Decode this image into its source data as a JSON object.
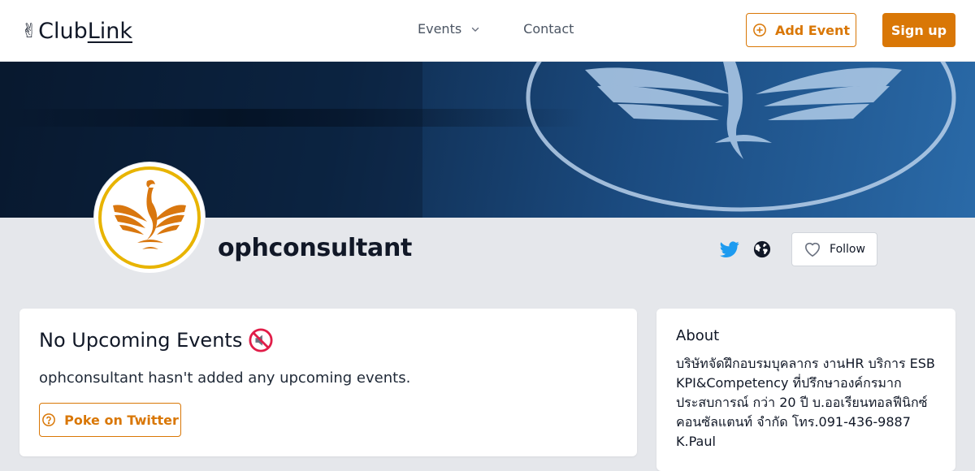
{
  "header": {
    "logo_hand": "✌",
    "logo_club": "Club",
    "logo_link": "Link",
    "nav": {
      "events_label": "Events",
      "contact_label": "Contact"
    },
    "add_event_label": "Add Event",
    "signup_label": "Sign up"
  },
  "profile": {
    "name": "ophconsultant",
    "follow_label": "Follow"
  },
  "events": {
    "title": "No Upcoming Events",
    "message": "ophconsultant hasn't added any upcoming events.",
    "poke_label": "Poke on Twitter"
  },
  "about": {
    "title": "About",
    "lines": [
      "บริษัทจัดฝึกอบรมบุคลากร งานHR บริการ ESB",
      "KPI&Competency ที่ปรึกษาองค์กรมาก",
      "ประสบการณ์ กว่า 20 ปี บ.ออเรียนทอลฟีนิกซ์",
      "คอนซัลแตนท์ จำกัด โทร.091-436-9887",
      "K.Paul"
    ]
  },
  "colors": {
    "accent": "#d97706",
    "twitter": "#1d9bf0",
    "background": "#e5e7eb",
    "banner_dark": "#0a1c33"
  },
  "icons": {
    "logo": "victory-hand-icon",
    "events_dropdown": "chevron-down-icon",
    "add_event": "plus-circle-icon",
    "twitter": "twitter-icon",
    "website": "globe-icon",
    "follow": "heart-outline-icon",
    "no_events": "muted-speaker-icon",
    "poke": "question-circle-icon"
  }
}
